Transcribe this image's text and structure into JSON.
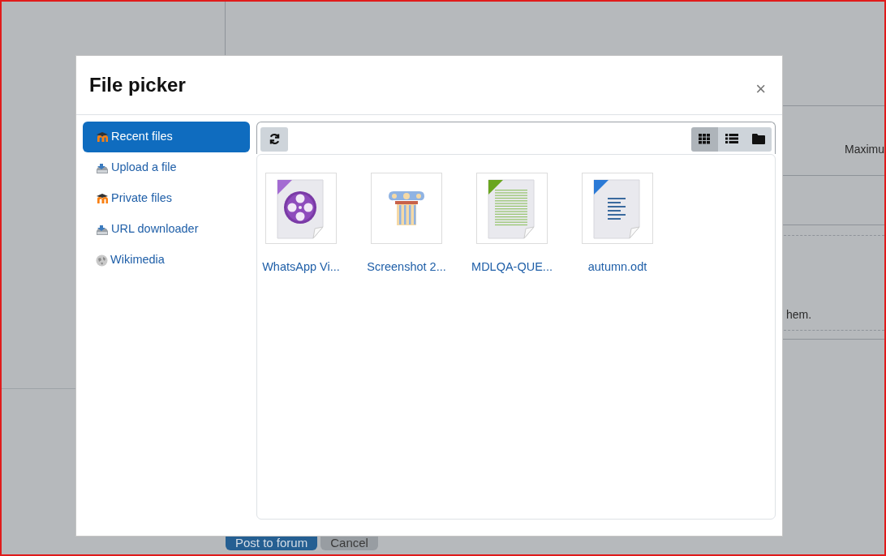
{
  "background": {
    "column_header": "Maximu",
    "note": "hem.",
    "buttons": [
      {
        "label": "Post to forum",
        "kind": "primary"
      },
      {
        "label": "Cancel",
        "kind": "secondary"
      }
    ]
  },
  "dialog": {
    "title": "File picker",
    "close": "×",
    "repositories": [
      {
        "label": "Recent files",
        "kind": "moodle",
        "selected": true
      },
      {
        "label": "Upload a file",
        "kind": "upload",
        "selected": false
      },
      {
        "label": "Private files",
        "kind": "moodle",
        "selected": false
      },
      {
        "label": "URL downloader",
        "kind": "upload",
        "selected": false
      },
      {
        "label": "Wikimedia",
        "kind": "globe",
        "selected": false
      }
    ],
    "views": [
      {
        "kind": "grid",
        "selected": true
      },
      {
        "kind": "list",
        "selected": false
      },
      {
        "kind": "folder",
        "selected": false
      }
    ],
    "files": [
      {
        "name": "WhatsApp Vi...",
        "kind": "video"
      },
      {
        "name": "Screenshot 2...",
        "kind": "image"
      },
      {
        "name": "MDLQA-QUE...",
        "kind": "document"
      },
      {
        "name": "autumn.odt",
        "kind": "text"
      }
    ]
  }
}
